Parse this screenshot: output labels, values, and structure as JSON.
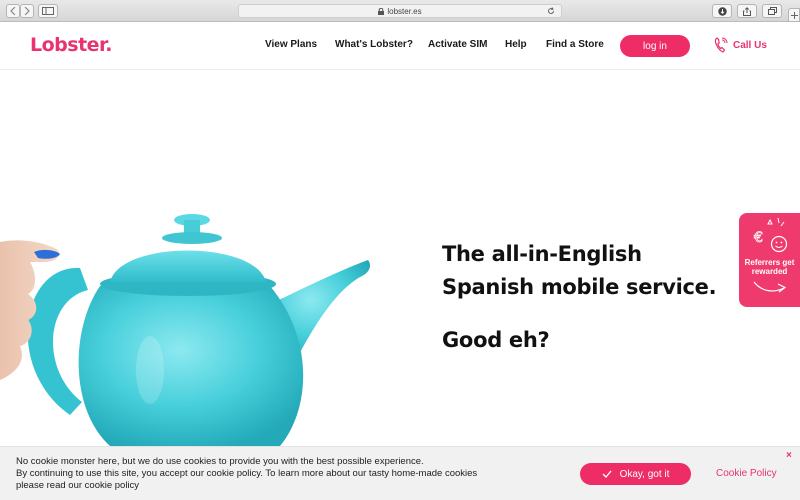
{
  "browser": {
    "url": "lobster.es"
  },
  "header": {
    "logo": "Lobster.",
    "nav": [
      "View Plans",
      "What's Lobster?",
      "Activate SIM",
      "Help",
      "Find a Store"
    ],
    "login_label": "log in",
    "call_label": "Call Us"
  },
  "hero": {
    "headline_line1": "The all-in-English",
    "headline_line2": "Spanish mobile service.",
    "subline": "Good eh?"
  },
  "referral": {
    "label": "Referrers get rewarded"
  },
  "cookie": {
    "line1": "No cookie monster here, but we do use cookies to provide you with the best possible experience.",
    "line2": "By continuing to use this site, you accept our cookie policy. To learn more about our tasty home-made cookies",
    "line3": "please read our cookie policy",
    "ok_label": "Okay, got it",
    "policy_label": "Cookie Policy",
    "close_label": "×"
  },
  "colors": {
    "brand": "#e8336f",
    "teapot": "#4fd0dc"
  },
  "icons": [
    "back-icon",
    "forward-icon",
    "sidebar-icon",
    "lock-icon",
    "reload-icon",
    "download-icon",
    "share-icon",
    "tabs-icon",
    "new-tab-icon",
    "phone-icon",
    "euro-icon",
    "smile-icon",
    "arrow-icon",
    "check-icon",
    "close-icon"
  ]
}
